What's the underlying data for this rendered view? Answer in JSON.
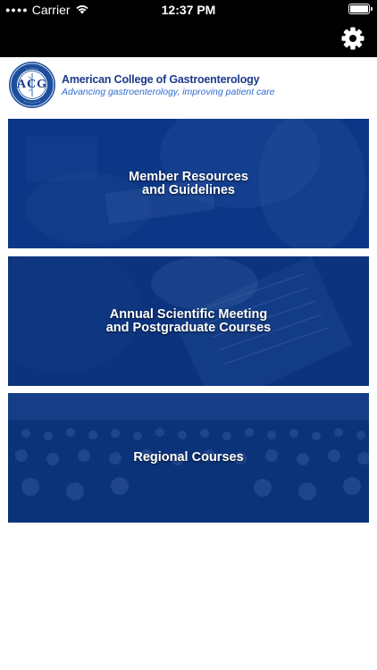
{
  "status_bar": {
    "carrier": "Carrier",
    "time": "12:37 PM",
    "battery_level": 1.0
  },
  "nav": {
    "settings_icon": "gear-icon"
  },
  "header": {
    "logo_seal_icon": "acg-seal-icon",
    "seal_text": "ACG",
    "org_name": "American College of Gastroenterology",
    "tagline": "Advancing gastroenterology, improving patient care"
  },
  "tiles": [
    {
      "label": "Member Resources\nand Guidelines"
    },
    {
      "label": "Annual Scientific Meeting\nand Postgraduate Courses"
    },
    {
      "label": "Regional Courses"
    }
  ],
  "colors": {
    "status_bar_bg": "#000000",
    "brand_dark_blue": "#1d3a8a",
    "brand_light_blue": "#2f6cd0",
    "tile_blue": "#0d3a8c"
  }
}
